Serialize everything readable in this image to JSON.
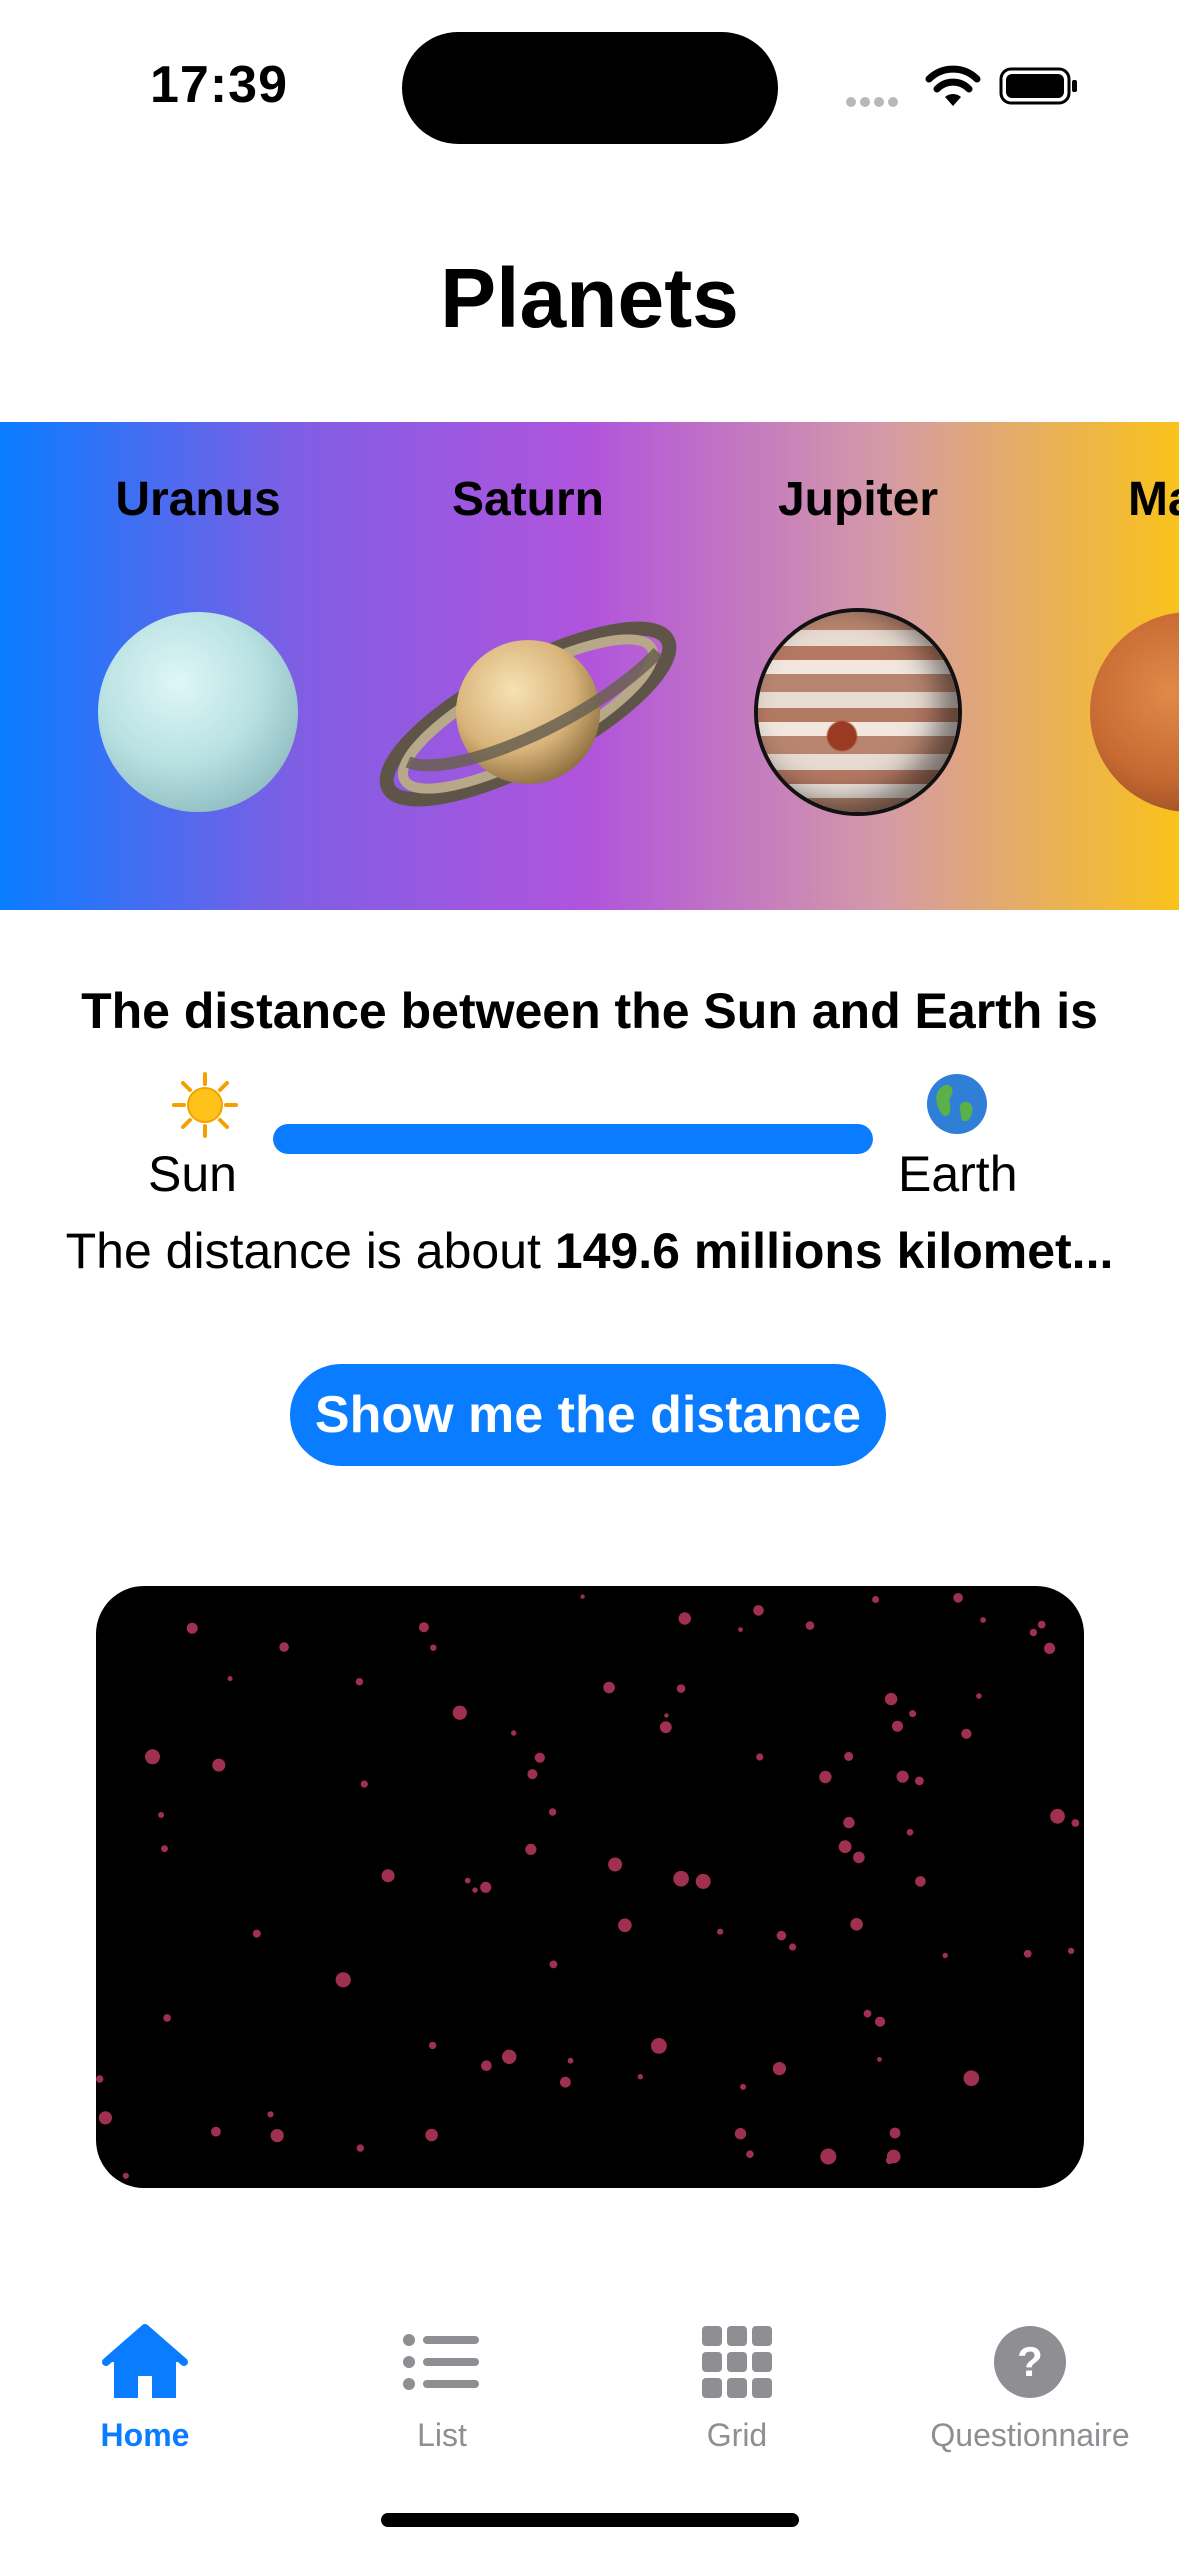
{
  "status_bar": {
    "time": "17:39"
  },
  "title": "Planets",
  "carousel": {
    "planets": [
      {
        "name": "Uranus"
      },
      {
        "name": "Saturn"
      },
      {
        "name": "Jupiter"
      },
      {
        "name": "Mars",
        "visible_text": "Ma"
      }
    ]
  },
  "distance": {
    "heading": "The distance between the Sun and Earth is",
    "from_label": "Sun",
    "to_label": "Earth",
    "progress_fraction": 1.0,
    "text_prefix": "The distance is about ",
    "text_value": "149.6 millions kilomet..."
  },
  "show_button_label": "Show me the distance",
  "tabs": [
    {
      "label": "Home",
      "icon": "house-icon",
      "active": true
    },
    {
      "label": "List",
      "icon": "list-icon",
      "active": false
    },
    {
      "label": "Grid",
      "icon": "grid-icon",
      "active": false
    },
    {
      "label": "Questionnaire",
      "icon": "question-icon",
      "active": false
    }
  ],
  "colors": {
    "accent": "#0A7CFF",
    "star_dots": "#A03050",
    "inactive_tab": "#8E8E93"
  }
}
